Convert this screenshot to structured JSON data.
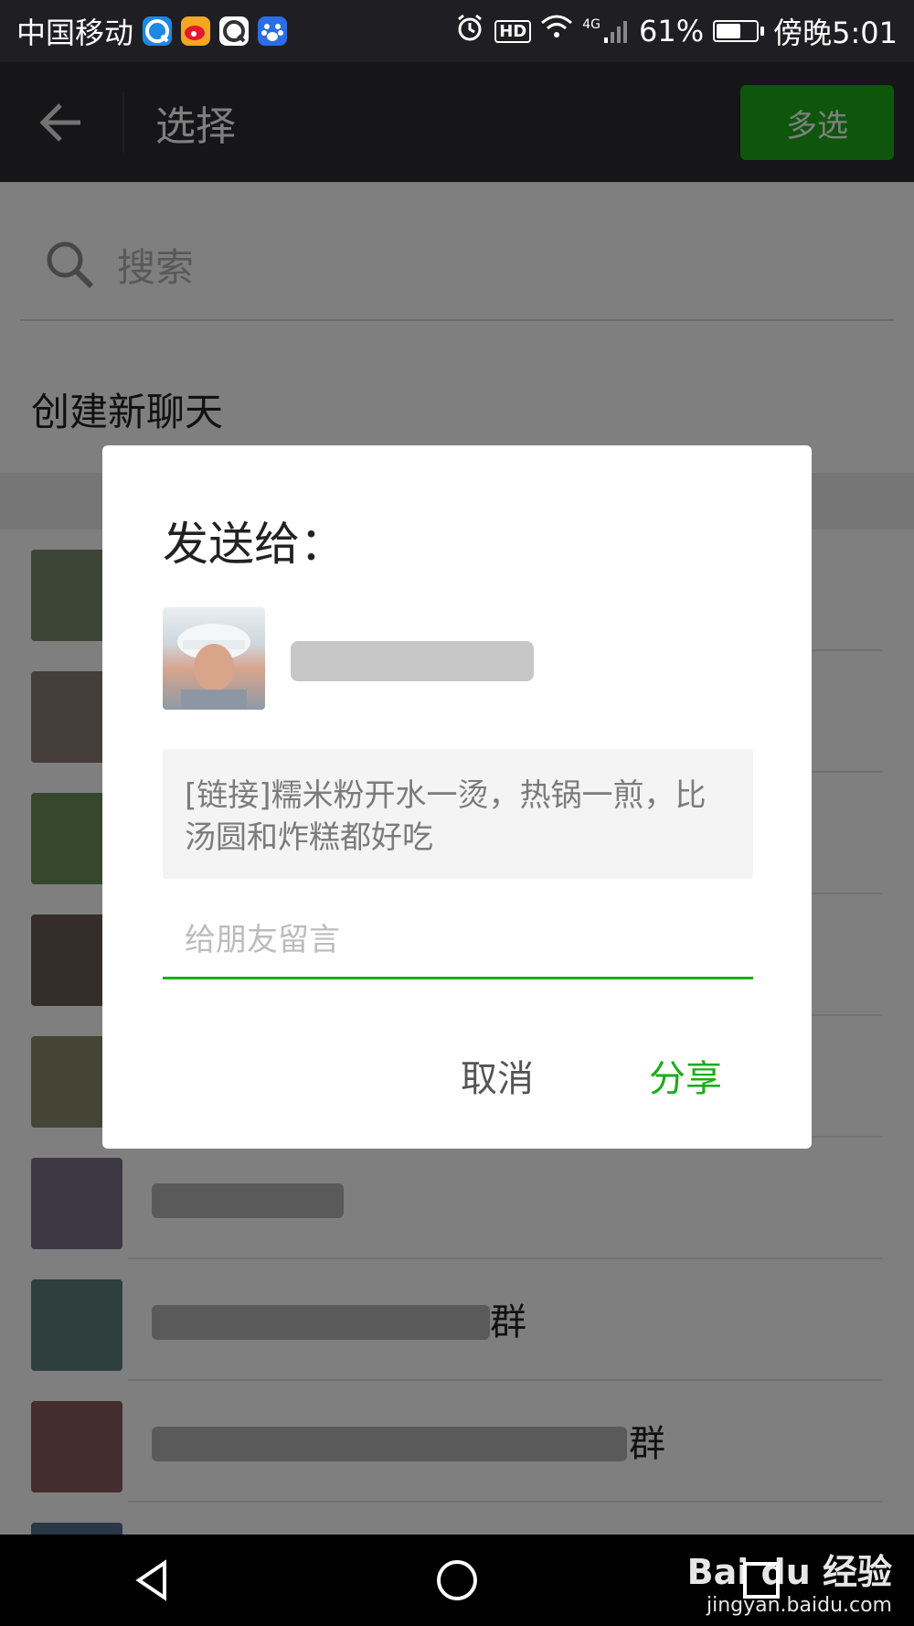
{
  "status_bar": {
    "carrier": "中国移动",
    "app_icons": [
      "qq-browser-icon",
      "weibo-icon",
      "qq-icon",
      "baidu-icon"
    ],
    "hd_label": "HD",
    "network_label": "4G",
    "battery_percent": "61%",
    "battery_level": 0.61,
    "time": "傍晚5:01"
  },
  "header": {
    "title": "选择",
    "multi_select_label": "多选"
  },
  "search": {
    "placeholder": "搜索"
  },
  "list": {
    "new_chat_label": "创建新聊天",
    "visible_name_tails": [
      "群",
      "群"
    ]
  },
  "dialog": {
    "title": "发送给：",
    "link_text": "[链接]糯米粉开水一烫，热锅一煎，比汤圆和炸糕都好吃",
    "message_placeholder": "给朋友留言",
    "cancel_label": "取消",
    "share_label": "分享"
  },
  "watermark": {
    "main": "Bai du 经验",
    "sub": "jingyan.baidu.com"
  },
  "colors": {
    "accent_green": "#1aad19",
    "header_bg": "#2c2c30",
    "status_bg": "#1f1f23"
  }
}
